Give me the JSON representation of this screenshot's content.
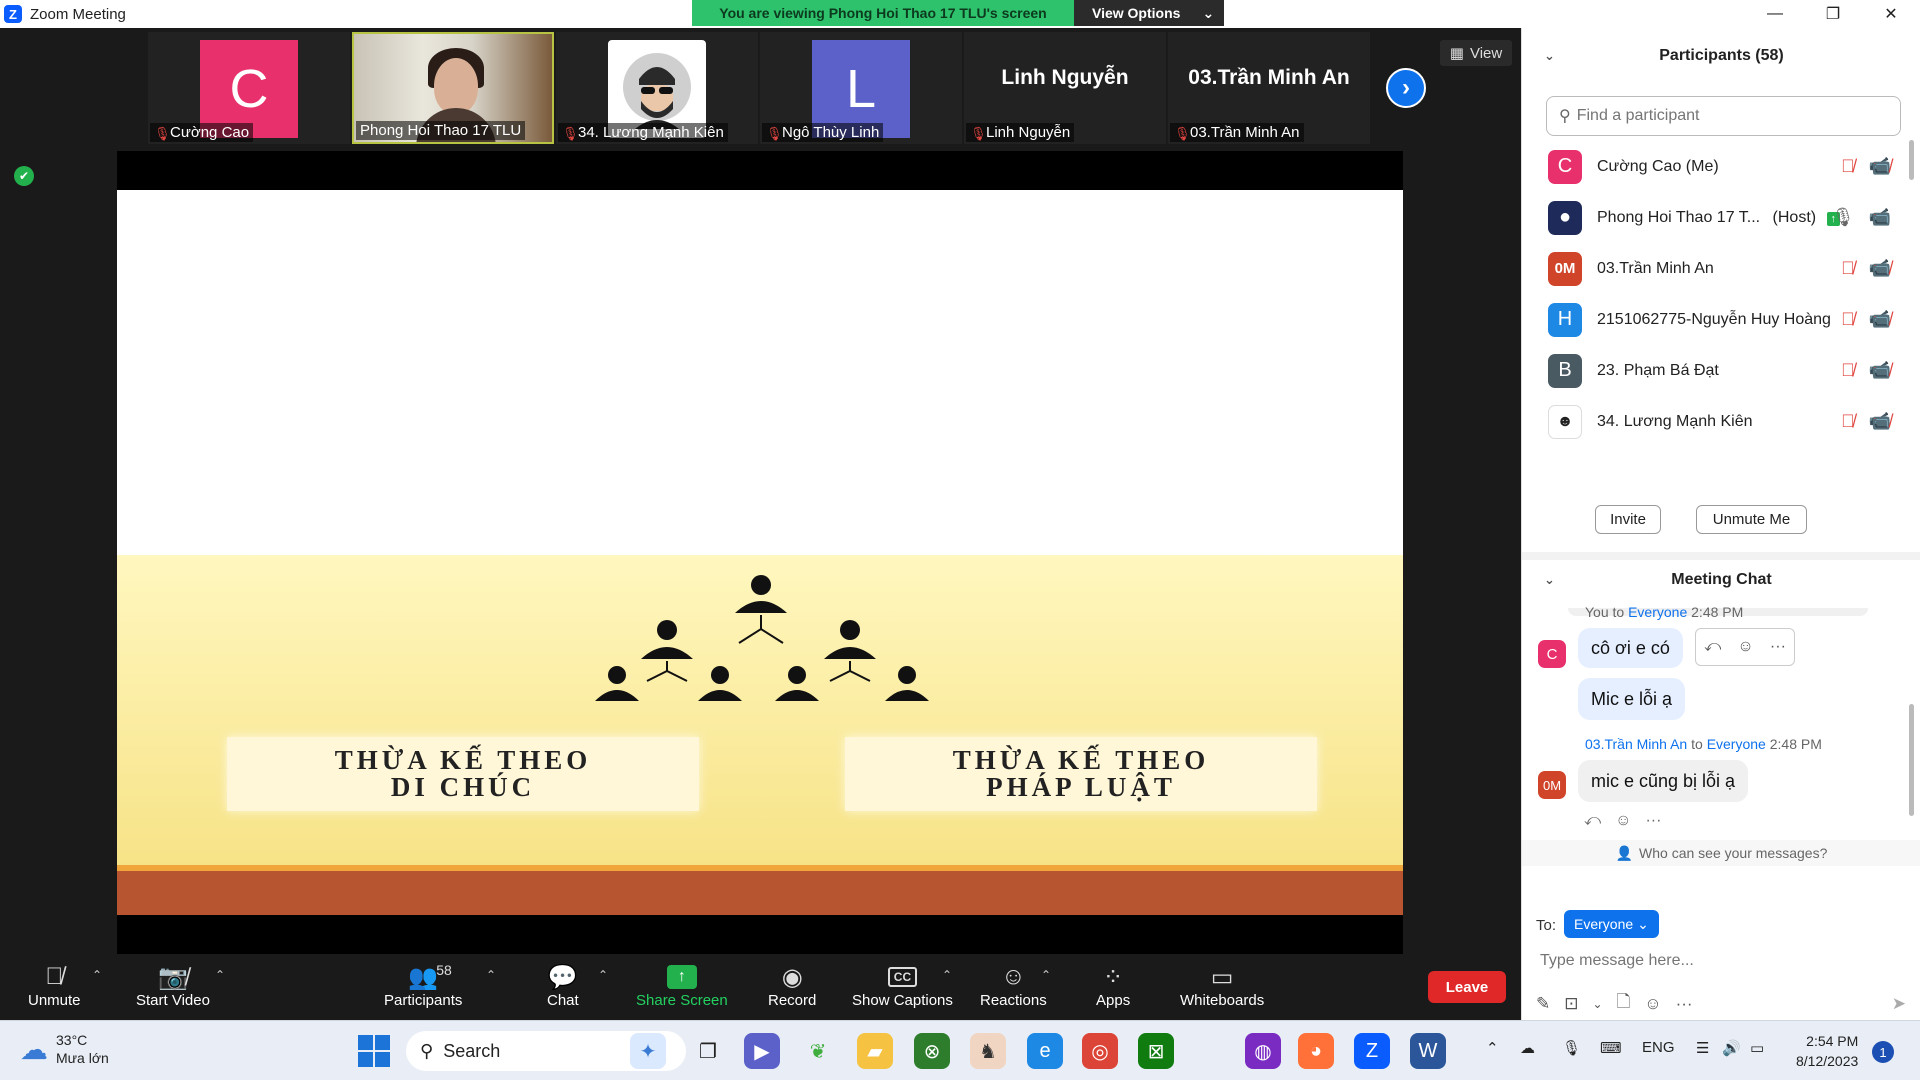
{
  "window": {
    "title": "Zoom Meeting",
    "banner_text": "You are viewing Phong Hoi Thao 17 TLU's screen",
    "view_options_label": "View Options",
    "minimize": "—",
    "maximize": "❐",
    "close": "✕"
  },
  "stage": {
    "view_label": "View",
    "tiles": [
      {
        "initial": "C",
        "color": "#e8316c",
        "name": "Cường Cao"
      },
      {
        "initial": "",
        "color": "",
        "name": "Phong Hoi Thao 17 TLU"
      },
      {
        "initial": "",
        "color": "",
        "name": "34. Lương Mạnh Kiên"
      },
      {
        "initial": "L",
        "color": "#5b61c9",
        "name": "Ngô Thùy Linh"
      },
      {
        "big": "Linh Nguyễn",
        "name": "Linh Nguyễn"
      },
      {
        "big": "03.Trần Minh An",
        "name": "03.Trần Minh An"
      }
    ]
  },
  "slide": {
    "box_left": "THỪA KẾ THEO\nDI CHÚC",
    "box_right": "THỪA KẾ THEO\nPHÁP LUẬT"
  },
  "toolbar": {
    "unmute": "Unmute",
    "start_video": "Start Video",
    "participants": "Participants",
    "participants_count": "58",
    "chat": "Chat",
    "share_screen": "Share Screen",
    "record": "Record",
    "show_captions": "Show Captions",
    "reactions": "Reactions",
    "apps": "Apps",
    "whiteboards": "Whiteboards",
    "leave": "Leave"
  },
  "participants_panel": {
    "title": "Participants (58)",
    "search_placeholder": "Find a participant",
    "rows": [
      {
        "initial": "C",
        "color": "#e8316c",
        "name": "Cường Cao (Me)"
      },
      {
        "initial": "",
        "color": "#1e2a5a",
        "name": "Phong Hoi Thao 17 T...",
        "tag": "(Host)"
      },
      {
        "initial": "0M",
        "color": "#d0442a",
        "name": "03.Trần Minh An"
      },
      {
        "initial": "H",
        "color": "#1e88e5",
        "name": "2151062775-Nguyễn Huy Hoàng"
      },
      {
        "initial": "B",
        "color": "#4a5a63",
        "name": "23. Phạm Bá Đạt"
      },
      {
        "initial": "",
        "color": "#ffffff",
        "name": "34. Lương Mạnh Kiên"
      }
    ],
    "invite": "Invite",
    "unmute_me": "Unmute Me"
  },
  "chat_panel": {
    "title": "Meeting Chat",
    "messages": [
      {
        "sender": "You",
        "to_word": "to",
        "recipient": "Everyone",
        "time": "2:48 PM",
        "avatar": "C",
        "avatar_color": "#e8316c",
        "lines": [
          "cô ơi e có",
          "Mic e lỗi ạ"
        ]
      },
      {
        "sender": "03.Trần Minh An",
        "to_word": "to",
        "recipient": "Everyone",
        "time": "2:48 PM",
        "avatar": "0M",
        "avatar_color": "#d0442a",
        "lines": [
          "mic e cũng bị lỗi ạ"
        ]
      }
    ],
    "who_can_see": "Who can see your messages?",
    "to_label": "To:",
    "recipient_button": "Everyone",
    "input_placeholder": "Type message here..."
  },
  "taskbar": {
    "temp": "33°C",
    "weather": "Mưa lớn",
    "search": "Search",
    "lang": "ENG",
    "time": "2:54 PM",
    "date": "8/12/2023",
    "notifications": "1"
  }
}
